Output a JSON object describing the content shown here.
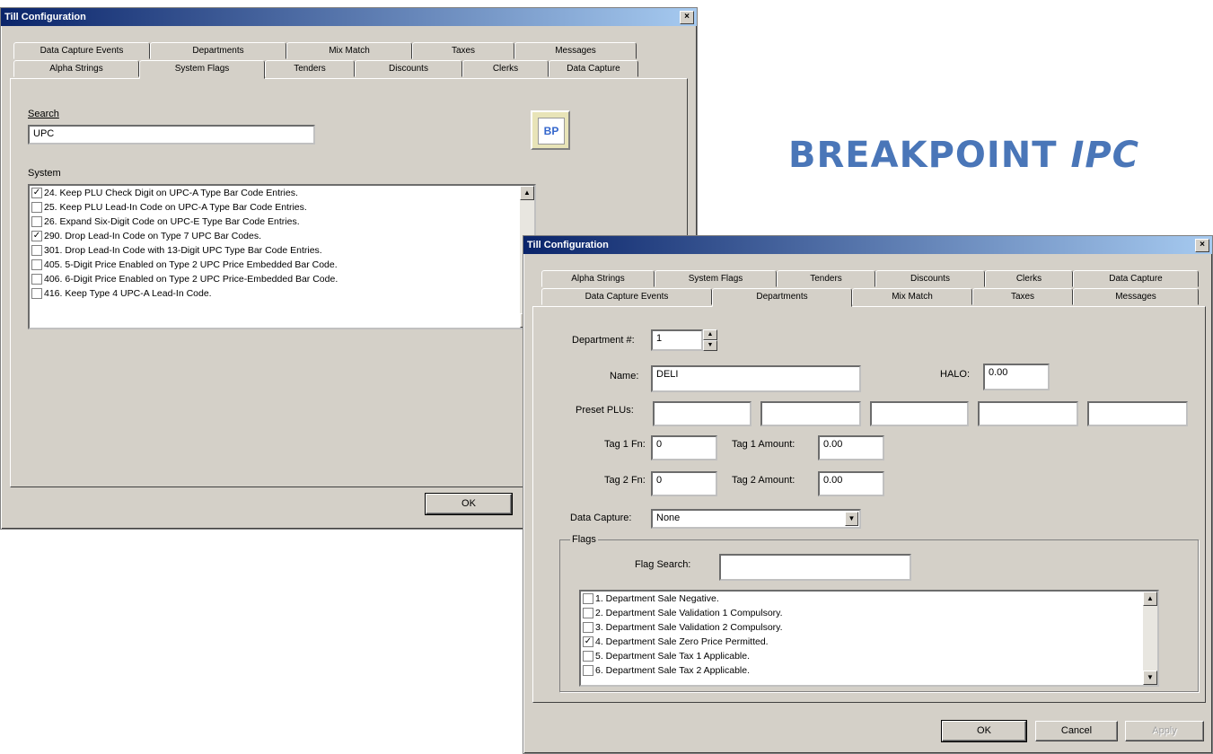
{
  "brand": {
    "word1": "BREAKPOINT",
    "word2": "IPC"
  },
  "window1": {
    "title": "Till Configuration",
    "close_label": "×",
    "tabs_back": [
      "Data Capture Events",
      "Departments",
      "Mix Match",
      "Taxes",
      "Messages"
    ],
    "tabs_front": [
      "Alpha Strings",
      "System Flags",
      "Tenders",
      "Discounts",
      "Clerks",
      "Data Capture"
    ],
    "active_tab": "System Flags",
    "search_label": "Search",
    "search_value": "UPC",
    "app_icon_text": "BP",
    "system_label": "System",
    "items": [
      {
        "text": "24. Keep PLU Check Digit on UPC-A Type Bar Code Entries.",
        "checked": true
      },
      {
        "text": "25. Keep PLU Lead-In Code on UPC-A Type Bar Code Entries.",
        "checked": false
      },
      {
        "text": "26. Expand Six-Digit Code on UPC-E Type Bar Code Entries.",
        "checked": false
      },
      {
        "text": "290. Drop Lead-In Code on Type 7 UPC Bar Codes.",
        "checked": true
      },
      {
        "text": "301. Drop Lead-In Code with 13-Digit UPC Type Bar Code Entries.",
        "checked": false
      },
      {
        "text": "405. 5-Digit Price Enabled on Type 2 UPC Price Embedded Bar Code.",
        "checked": false
      },
      {
        "text": "406. 6-Digit Price Enabled on Type 2 UPC Price-Embedded Bar Code.",
        "checked": false
      },
      {
        "text": "416. Keep Type 4 UPC-A Lead-In Code.",
        "checked": false
      }
    ],
    "ok_label": "OK"
  },
  "window2": {
    "title": "Till Configuration",
    "close_label": "×",
    "tabs_back": [
      "Alpha Strings",
      "System Flags",
      "Tenders",
      "Discounts",
      "Clerks",
      "Data Capture"
    ],
    "tabs_front": [
      "Data Capture Events",
      "Departments",
      "Mix Match",
      "Taxes",
      "Messages"
    ],
    "active_tab": "Departments",
    "dept_label": "Department #:",
    "dept_value": "1",
    "name_label": "Name:",
    "name_value": "DELI",
    "halo_label": "HALO:",
    "halo_value": "0.00",
    "preset_label": "Preset PLUs:",
    "preset_values": [
      "",
      "",
      "",
      "",
      ""
    ],
    "tag1fn_label": "Tag 1 Fn:",
    "tag1fn_value": "0",
    "tag1amt_label": "Tag 1 Amount:",
    "tag1amt_value": "0.00",
    "tag2fn_label": "Tag 2 Fn:",
    "tag2fn_value": "0",
    "tag2amt_label": "Tag 2 Amount:",
    "tag2amt_value": "0.00",
    "datacapture_label": "Data Capture:",
    "datacapture_value": "None",
    "flags_label": "Flags",
    "flagsearch_label": "Flag Search:",
    "flagsearch_value": "",
    "flags": [
      {
        "text": "1. Department Sale Negative.",
        "checked": false
      },
      {
        "text": "2. Department Sale Validation 1 Compulsory.",
        "checked": false
      },
      {
        "text": "3. Department Sale Validation 2 Compulsory.",
        "checked": false
      },
      {
        "text": "4. Department Sale Zero Price Permitted.",
        "checked": true
      },
      {
        "text": "5. Department Sale Tax 1 Applicable.",
        "checked": false
      },
      {
        "text": "6. Department Sale Tax 2 Applicable.",
        "checked": false
      }
    ],
    "ok_label": "OK",
    "cancel_label": "Cancel",
    "apply_label": "Apply"
  }
}
